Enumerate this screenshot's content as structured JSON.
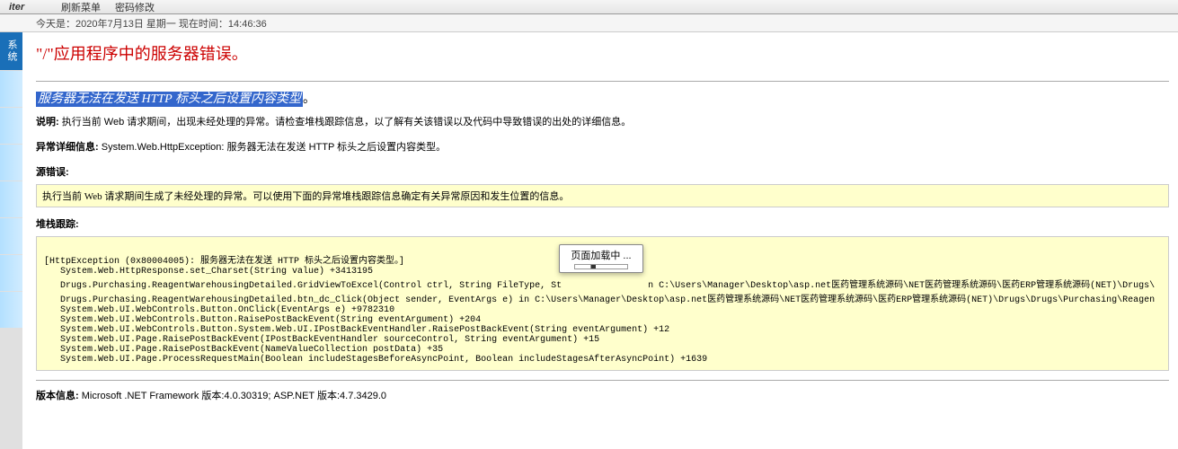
{
  "top": {
    "brand": "iter",
    "menus": [
      "刷新菜单",
      "密码修改"
    ]
  },
  "datebar": {
    "text": "今天是：2020年7月13日 星期一 现在时间：14:46:36"
  },
  "sidebar": {
    "tabs": [
      {
        "label": "系统",
        "active": true
      },
      {
        "label": "",
        "active": false
      },
      {
        "label": "",
        "active": false
      },
      {
        "label": "",
        "active": false
      },
      {
        "label": "",
        "active": false
      },
      {
        "label": "",
        "active": false
      },
      {
        "label": "",
        "active": false
      },
      {
        "label": "",
        "active": false
      }
    ]
  },
  "error": {
    "title": "\"/\"应用程序中的服务器错误。",
    "subtitle": "服务器无法在发送 HTTP 标头之后设置内容类型",
    "subtitle_after": "。",
    "description_label": "说明:",
    "description_text": " 执行当前 Web 请求期间，出现未经处理的异常。请检查堆栈跟踪信息，以了解有关该错误以及代码中导致错误的出处的详细信息。",
    "exception_label": "异常详细信息:",
    "exception_text": " System.Web.HttpException: 服务器无法在发送 HTTP 标头之后设置内容类型。",
    "source_error_label": "源错误:",
    "source_error_text": "执行当前 Web 请求期间生成了未经处理的异常。可以使用下面的异常堆栈跟踪信息确定有关异常原因和发生位置的信息。",
    "stacktrace_label": "堆栈跟踪:",
    "stacktrace": "\n[HttpException (0x80004005): 服务器无法在发送 HTTP 标头之后设置内容类型。]\n   System.Web.HttpResponse.set_Charset(String value) +3413195\n   Drugs.Purchasing.ReagentWarehousingDetailed.GridViewToExcel(Control ctrl, String FileType, St                n C:\\Users\\Manager\\Desktop\\asp.net医药管理系统源码\\NET医药管理系统源码\\医药ERP管理系统源码(NET)\\Drugs\\\n   Drugs.Purchasing.ReagentWarehousingDetailed.btn_dc_Click(Object sender, EventArgs e) in C:\\Users\\Manager\\Desktop\\asp.net医药管理系统源码\\NET医药管理系统源码\\医药ERP管理系统源码(NET)\\Drugs\\Drugs\\Purchasing\\Reagen\n   System.Web.UI.WebControls.Button.OnClick(EventArgs e) +9782310\n   System.Web.UI.WebControls.Button.RaisePostBackEvent(String eventArgument) +204\n   System.Web.UI.WebControls.Button.System.Web.UI.IPostBackEventHandler.RaisePostBackEvent(String eventArgument) +12\n   System.Web.UI.Page.RaisePostBackEvent(IPostBackEventHandler sourceControl, String eventArgument) +15\n   System.Web.UI.Page.RaisePostBackEvent(NameValueCollection postData) +35\n   System.Web.UI.Page.ProcessRequestMain(Boolean includeStagesBeforeAsyncPoint, Boolean includeStagesAfterAsyncPoint) +1639\n",
    "version_label": "版本信息:",
    "version_text": " Microsoft .NET Framework 版本:4.0.30319; ASP.NET 版本:4.7.3429.0"
  },
  "loading": {
    "text": "页面加载中 ..."
  }
}
